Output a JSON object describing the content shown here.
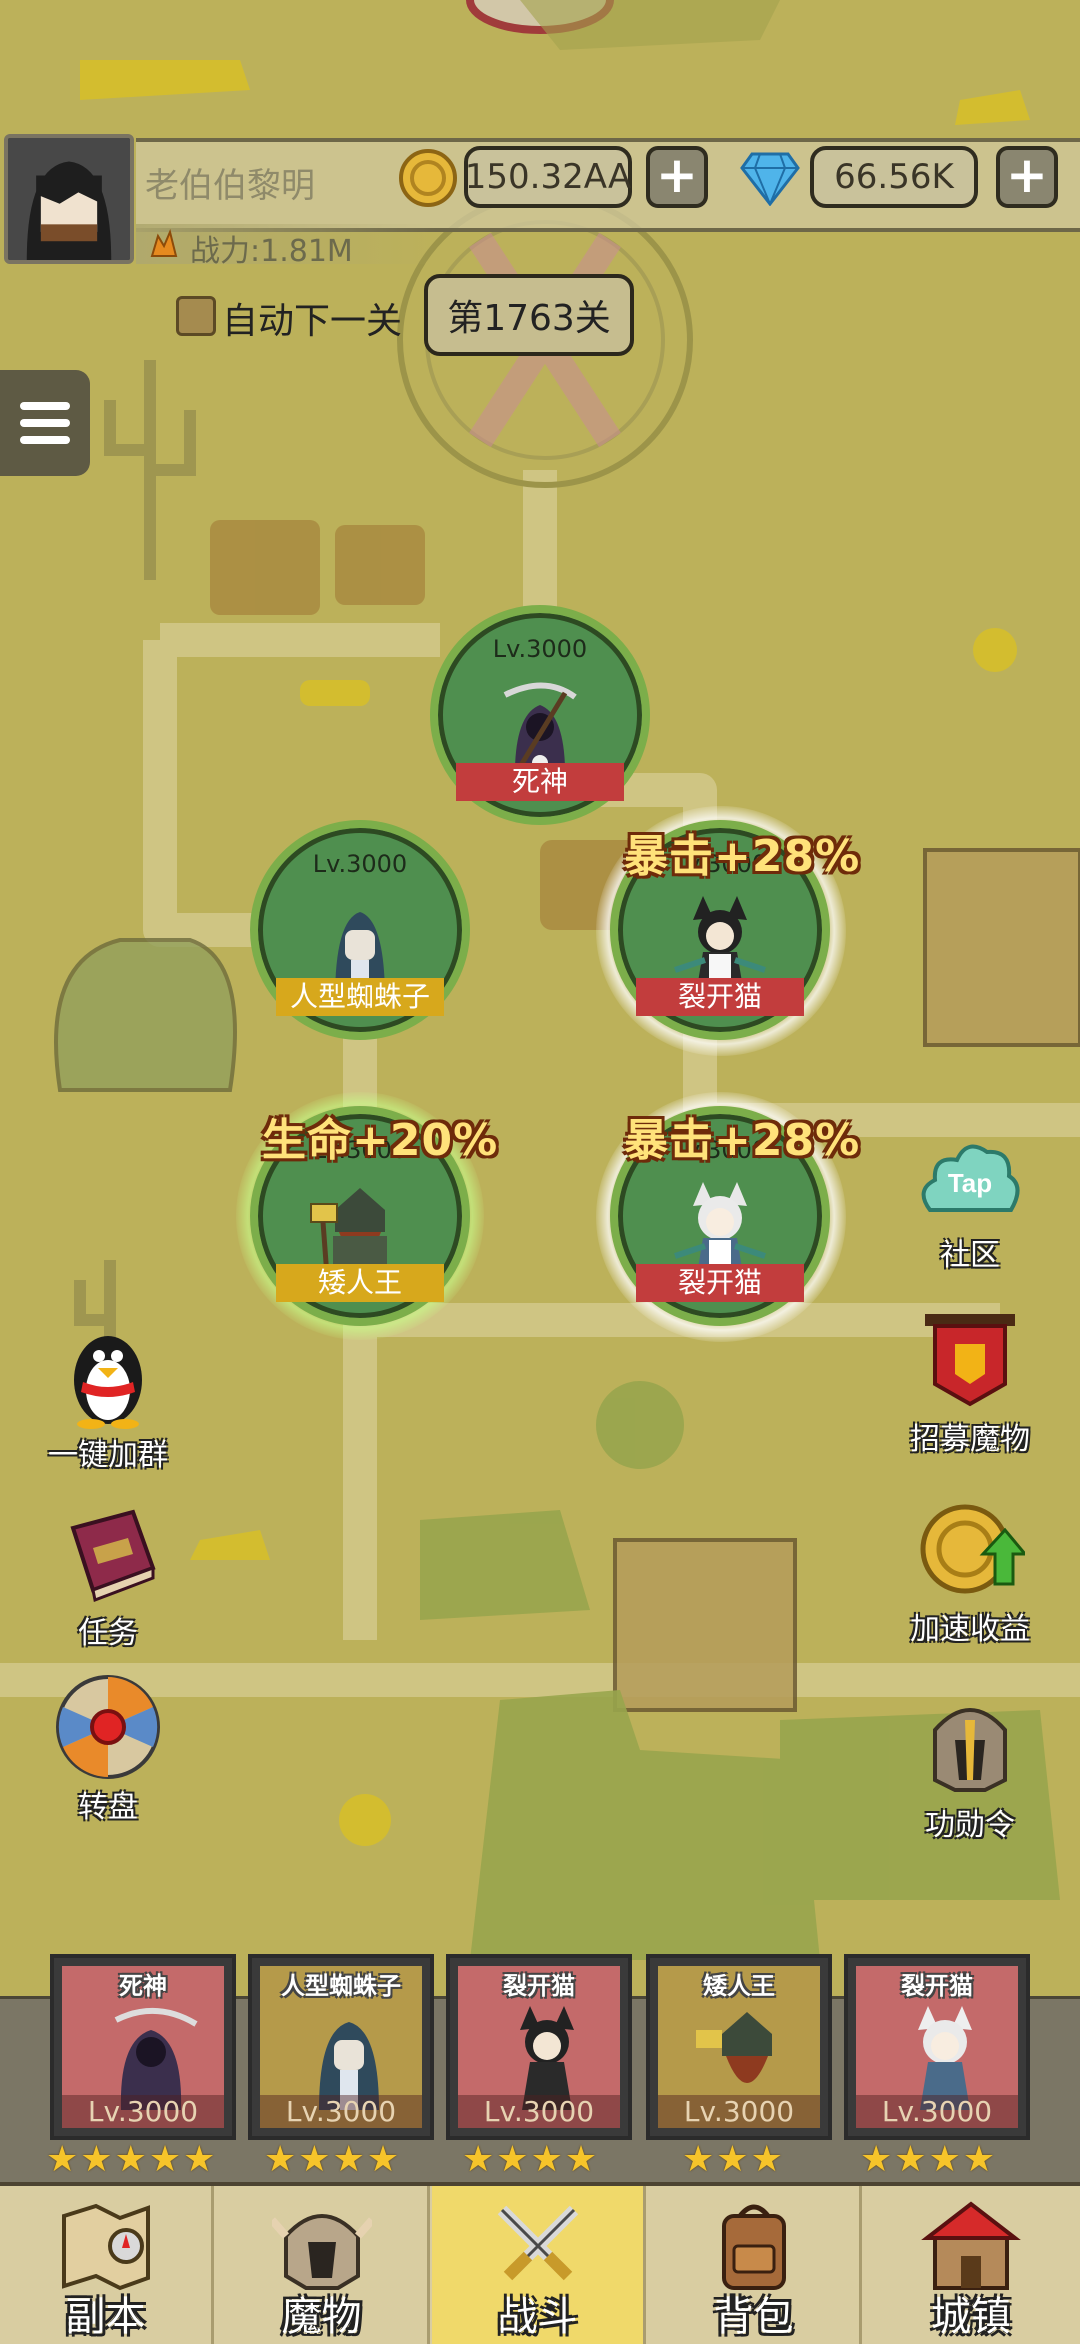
{
  "player": {
    "name": "老伯伯黎明",
    "power": "战力:1.81M",
    "gold": "150.32AA",
    "gems": "66.56K",
    "add_symbol": "+"
  },
  "stage": {
    "auto_next_label": "自动下一关",
    "auto_next_checked": false,
    "current_stage": "第1763关"
  },
  "formation": [
    {
      "level": "Lv.3000",
      "name": "死神",
      "tag_color": "red"
    },
    {
      "level": "Lv.3000",
      "name": "人型蜘蛛子",
      "tag_color": "yellow"
    },
    {
      "level": "Lv.3000",
      "name": "裂开猫",
      "tag_color": "red",
      "buff": "暴击+28%"
    },
    {
      "level": "Lv.3000",
      "name": "矮人王",
      "tag_color": "yellow",
      "buff": "生命+20%"
    },
    {
      "level": "Lv.3000",
      "name": "裂开猫",
      "tag_color": "red",
      "buff": "暴击+28%"
    }
  ],
  "side_left": [
    {
      "label": "一键加群",
      "icon": "penguin-icon"
    },
    {
      "label": "任务",
      "icon": "quest-book-icon"
    },
    {
      "label": "转盘",
      "icon": "wheel-icon"
    }
  ],
  "side_right": [
    {
      "label": "社区",
      "icon": "tap-cloud-icon",
      "badge": "Tap"
    },
    {
      "label": "招募魔物",
      "icon": "recruit-banner-icon"
    },
    {
      "label": "加速收益",
      "icon": "coin-boost-icon"
    },
    {
      "label": "功勋令",
      "icon": "helmet-icon"
    }
  ],
  "team": [
    {
      "name": "死神",
      "level": "Lv.3000",
      "stars": 5
    },
    {
      "name": "人型蜘蛛子",
      "level": "Lv.3000",
      "stars": 4
    },
    {
      "name": "裂开猫",
      "level": "Lv.3000",
      "stars": 4
    },
    {
      "name": "矮人王",
      "level": "Lv.3000",
      "stars": 3
    },
    {
      "name": "裂开猫",
      "level": "Lv.3000",
      "stars": 4
    }
  ],
  "nav": [
    {
      "label": "副本",
      "icon": "map-icon",
      "active": false
    },
    {
      "label": "魔物",
      "icon": "monster-helmet-icon",
      "active": false
    },
    {
      "label": "战斗",
      "icon": "crossed-swords-icon",
      "active": true
    },
    {
      "label": "背包",
      "icon": "backpack-icon",
      "active": false
    },
    {
      "label": "城镇",
      "icon": "town-icon",
      "active": false
    }
  ],
  "colors": {
    "map_bg": "#bcb15a",
    "hero_ring": "#7cae4a",
    "tag_red": "#c23d3d",
    "tag_yellow": "#d7a81c",
    "active_tab": "#f0d96a"
  }
}
